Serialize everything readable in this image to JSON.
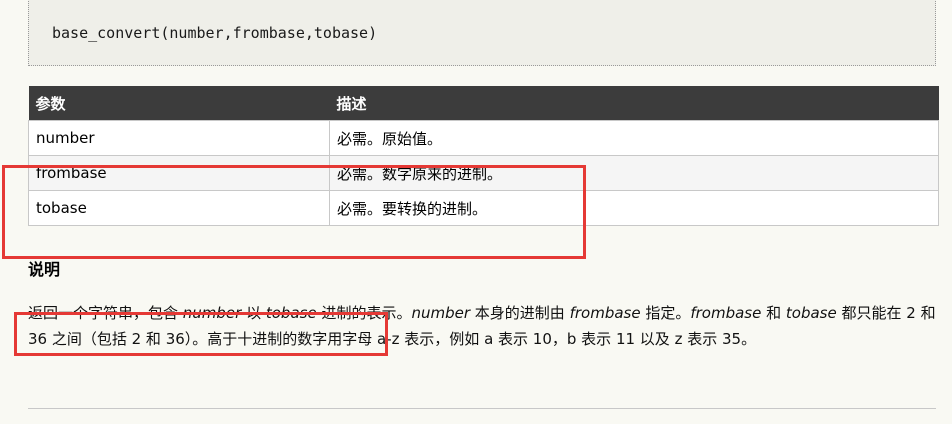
{
  "code": {
    "signature": "base_convert(number,frombase,tobase)"
  },
  "table": {
    "headers": [
      "参数",
      "描述"
    ],
    "rows": [
      {
        "param": "number",
        "desc": "必需。原始值。"
      },
      {
        "param": "frombase",
        "desc": "必需。数字原来的进制。"
      },
      {
        "param": "tobase",
        "desc": "必需。要转换的进制。"
      }
    ]
  },
  "section": {
    "title": "说明"
  },
  "description": {
    "t1": "返回一个字符串，包含 ",
    "e1": "number",
    "t2": " 以 ",
    "e2": "tobase",
    "t3": " 进制的表示。",
    "e3": "number",
    "t4": " 本身的进制由 ",
    "e4": "frombase",
    "t5": " 指定。",
    "e5": "frombase",
    "t6": " 和 ",
    "e6": "tobase",
    "t7": " 都只能在 2 和 36 之间（包括 2 和 36）。高于十进制的数字用字母 a-z 表示，例如 a 表示 10，b 表示 11 以及 z 表示 35。"
  },
  "colors": {
    "highlight": "#e53935",
    "header_bg": "#3c3c3c",
    "page_bg": "#f9f9f3"
  }
}
